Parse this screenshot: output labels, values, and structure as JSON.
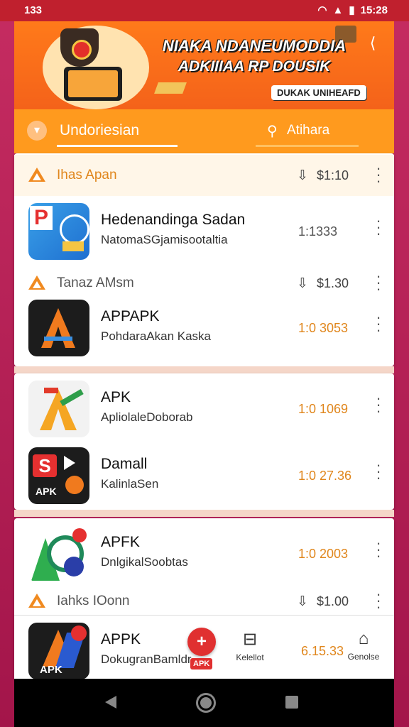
{
  "status": {
    "time_left": "133",
    "time_right": "15:28",
    "signal": "▲",
    "wifi": "◠",
    "battery": "▮"
  },
  "banner": {
    "title_line1": "NIAKA NDANEUMODDIA",
    "title_line2": "ADKIIIAA RP DOUSIK",
    "badge": "DUKAK UNIHEAFD",
    "share_icon": "share-icon",
    "accent": "#f4621a"
  },
  "tabs": {
    "language": "Undoriesian",
    "search": "Atihara",
    "accent": "#ff9a1e"
  },
  "rows": [
    {
      "type": "cat",
      "label": "Ihas Apan",
      "label_color": "#e0861c",
      "price": "$1:10"
    },
    {
      "type": "app",
      "name": "Hedenandinga Sadan",
      "sub": "NatomaSGjamisootaltia",
      "size": "1:1333",
      "size_grey": true,
      "icon": "pay-icon"
    },
    {
      "type": "cat",
      "label": "Tanaz AMsm",
      "label_color": "#555",
      "price": "$1.30"
    },
    {
      "type": "app",
      "name": "APPAPK",
      "sub": "PohdaraAkan Kaska",
      "size": "1:0 3053",
      "icon": "apk-a-dark-icon"
    },
    {
      "type": "app",
      "name": "APK",
      "sub": "ApliolaleDoborab",
      "size": "1:0 1069",
      "icon": "apk-a-light-icon"
    },
    {
      "type": "app",
      "name": "Damall",
      "sub": "KalinlaSen",
      "size": "1:0 27.36",
      "icon": "sapk-icon"
    },
    {
      "type": "app",
      "name": "APFK",
      "sub": "DnlgikalSoobtas",
      "size": "1:0 2003",
      "icon": "green-c-icon"
    },
    {
      "type": "cat",
      "label": "Iahks IOonn",
      "label_color": "#555",
      "price": "$1.00"
    },
    {
      "type": "app",
      "name": "APPK",
      "sub": "DokugranBamldr",
      "size": "6.15.33",
      "icon": "apk-dark-icon"
    }
  ],
  "fab": {
    "icon": "+",
    "label": "APK"
  },
  "bottom_nav": [
    {
      "icon": "⊟",
      "label": "Kelellot"
    },
    {
      "icon": "⌂",
      "label": "Genolse"
    }
  ],
  "navbar": {
    "back": "back-icon",
    "home": "home-icon",
    "recent": "recent-icon"
  }
}
